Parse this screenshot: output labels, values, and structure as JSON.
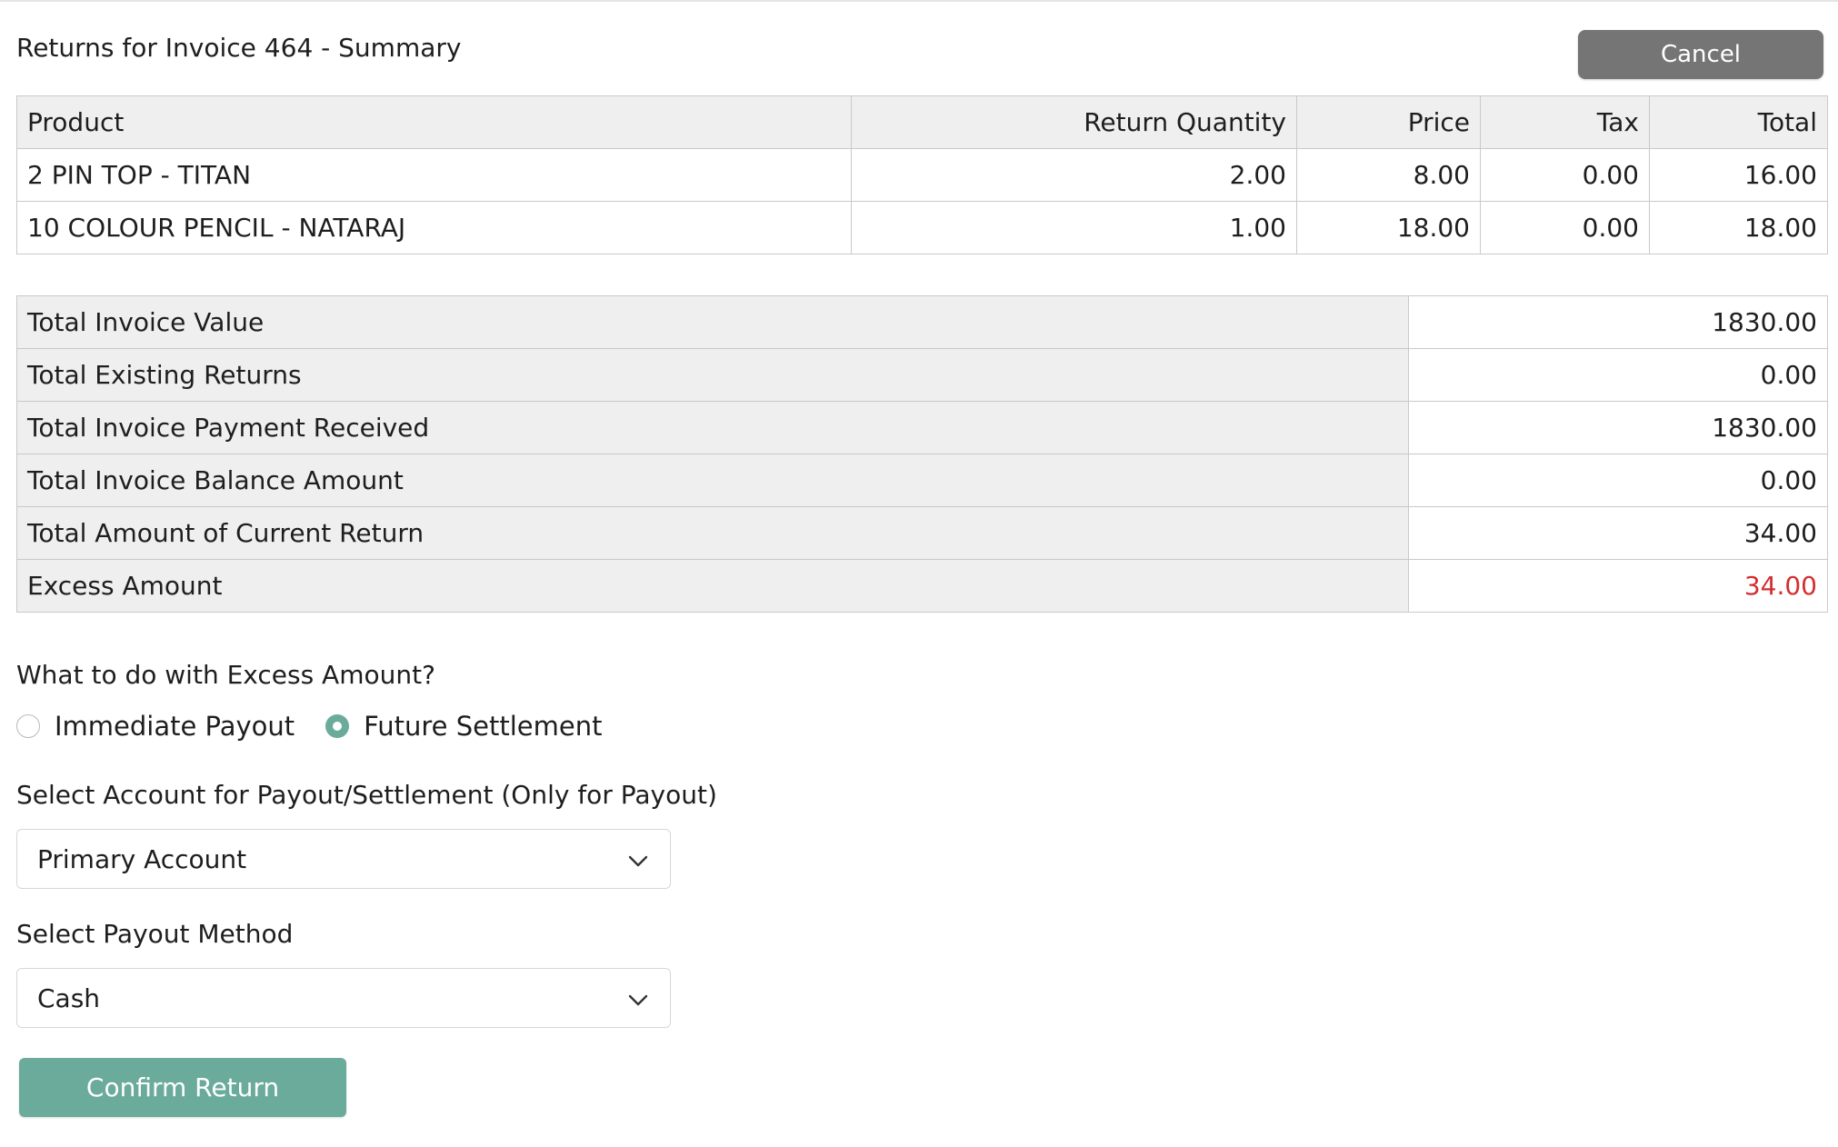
{
  "page": {
    "title": "Returns for Invoice 464 - Summary"
  },
  "actions": {
    "cancel_label": "Cancel",
    "confirm_label": "Confirm Return"
  },
  "items_table": {
    "headers": [
      "Product",
      "Return Quantity",
      "Price",
      "Tax",
      "Total"
    ],
    "rows": [
      [
        "2 PIN TOP - TITAN",
        "2.00",
        "8.00",
        "0.00",
        "16.00"
      ],
      [
        "10 COLOUR PENCIL - NATARAJ",
        "1.00",
        "18.00",
        "0.00",
        "18.00"
      ]
    ]
  },
  "summary": {
    "rows": [
      {
        "label": "Total Invoice Value",
        "value": "1830.00"
      },
      {
        "label": "Total Existing Returns",
        "value": "0.00"
      },
      {
        "label": "Total Invoice Payment Received",
        "value": "1830.00"
      },
      {
        "label": "Total Invoice Balance Amount",
        "value": "0.00"
      },
      {
        "label": "Total Amount of Current Return",
        "value": "34.00"
      },
      {
        "label": "Excess Amount",
        "value": "34.00"
      }
    ],
    "excess_color": "#d32f2f"
  },
  "excess_options": {
    "question": "What to do with Excess Amount?",
    "options": [
      {
        "label": "Immediate Payout",
        "selected": false
      },
      {
        "label": "Future Settlement",
        "selected": true
      }
    ]
  },
  "account_select": {
    "label": "Select Account for Payout/Settlement (Only for Payout)",
    "value": "Primary Account"
  },
  "method_select": {
    "label": "Select Payout Method",
    "value": "Cash"
  },
  "colors": {
    "accent": "#6aab9c",
    "cancel": "#757575",
    "header_bg": "#eeefee"
  },
  "icons": {
    "dropdown": "chevron-down-icon"
  }
}
